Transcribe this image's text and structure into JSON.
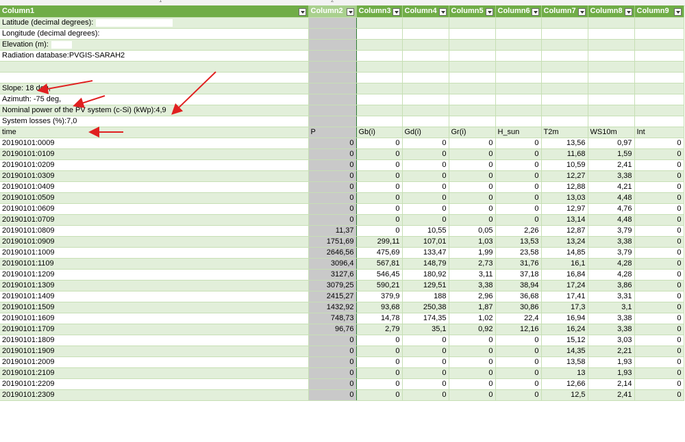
{
  "headers": [
    "Column1",
    "Column2",
    "Column3",
    "Column4",
    "Column5",
    "Column6",
    "Column7",
    "Column8",
    "Column9"
  ],
  "ruler_labels": [
    "1",
    "2"
  ],
  "meta_rows": [
    {
      "text": "Latitude (decimal degrees):",
      "box": true
    },
    {
      "text": "Longitude (decimal degrees):",
      "box": true
    },
    {
      "text": "Elevation (m):",
      "box": true
    },
    {
      "text": "Radiation database:PVGIS-SARAH2",
      "box": false
    },
    {
      "text": "",
      "box": false
    },
    {
      "text": "",
      "box": false
    },
    {
      "text": "Slope: 18 deg,",
      "box": false
    },
    {
      "text": "Azimuth: -75 deg,",
      "box": false
    },
    {
      "text": "Nominal power of the PV system (c-Si) (kWp):4,9",
      "box": false
    },
    {
      "text": "System losses (%):7,0",
      "box": false
    }
  ],
  "field_header": [
    "time",
    "P",
    "Gb(i)",
    "Gd(i)",
    "Gr(i)",
    "H_sun",
    "T2m",
    "WS10m",
    "Int"
  ],
  "rows": [
    [
      "20190101:0009",
      "0",
      "0",
      "0",
      "0",
      "0",
      "13,56",
      "0,97",
      "0"
    ],
    [
      "20190101:0109",
      "0",
      "0",
      "0",
      "0",
      "0",
      "11,68",
      "1,59",
      "0"
    ],
    [
      "20190101:0209",
      "0",
      "0",
      "0",
      "0",
      "0",
      "10,59",
      "2,41",
      "0"
    ],
    [
      "20190101:0309",
      "0",
      "0",
      "0",
      "0",
      "0",
      "12,27",
      "3,38",
      "0"
    ],
    [
      "20190101:0409",
      "0",
      "0",
      "0",
      "0",
      "0",
      "12,88",
      "4,21",
      "0"
    ],
    [
      "20190101:0509",
      "0",
      "0",
      "0",
      "0",
      "0",
      "13,03",
      "4,48",
      "0"
    ],
    [
      "20190101:0609",
      "0",
      "0",
      "0",
      "0",
      "0",
      "12,97",
      "4,76",
      "0"
    ],
    [
      "20190101:0709",
      "0",
      "0",
      "0",
      "0",
      "0",
      "13,14",
      "4,48",
      "0"
    ],
    [
      "20190101:0809",
      "11,37",
      "0",
      "10,55",
      "0,05",
      "2,26",
      "12,87",
      "3,79",
      "0"
    ],
    [
      "20190101:0909",
      "1751,69",
      "299,11",
      "107,01",
      "1,03",
      "13,53",
      "13,24",
      "3,38",
      "0"
    ],
    [
      "20190101:1009",
      "2646,56",
      "475,69",
      "133,47",
      "1,99",
      "23,58",
      "14,85",
      "3,79",
      "0"
    ],
    [
      "20190101:1109",
      "3096,4",
      "567,81",
      "148,79",
      "2,73",
      "31,76",
      "16,1",
      "4,28",
      "0"
    ],
    [
      "20190101:1209",
      "3127,6",
      "546,45",
      "180,92",
      "3,11",
      "37,18",
      "16,84",
      "4,28",
      "0"
    ],
    [
      "20190101:1309",
      "3079,25",
      "590,21",
      "129,51",
      "3,38",
      "38,94",
      "17,24",
      "3,86",
      "0"
    ],
    [
      "20190101:1409",
      "2415,27",
      "379,9",
      "188",
      "2,96",
      "36,68",
      "17,41",
      "3,31",
      "0"
    ],
    [
      "20190101:1509",
      "1432,92",
      "93,68",
      "250,38",
      "1,87",
      "30,86",
      "17,3",
      "3,1",
      "0"
    ],
    [
      "20190101:1609",
      "748,73",
      "14,78",
      "174,35",
      "1,02",
      "22,4",
      "16,94",
      "3,38",
      "0"
    ],
    [
      "20190101:1709",
      "96,76",
      "2,79",
      "35,1",
      "0,92",
      "12,16",
      "16,24",
      "3,38",
      "0"
    ],
    [
      "20190101:1809",
      "0",
      "0",
      "0",
      "0",
      "0",
      "15,12",
      "3,03",
      "0"
    ],
    [
      "20190101:1909",
      "0",
      "0",
      "0",
      "0",
      "0",
      "14,35",
      "2,21",
      "0"
    ],
    [
      "20190101:2009",
      "0",
      "0",
      "0",
      "0",
      "0",
      "13,58",
      "1,93",
      "0"
    ],
    [
      "20190101:2109",
      "0",
      "0",
      "0",
      "0",
      "0",
      "13",
      "1,93",
      "0"
    ],
    [
      "20190101:2209",
      "0",
      "0",
      "0",
      "0",
      "0",
      "12,66",
      "2,14",
      "0"
    ],
    [
      "20190101:2309",
      "0",
      "0",
      "0",
      "0",
      "0",
      "12,5",
      "2,41",
      "0"
    ]
  ],
  "colors": {
    "header": "#70ad47",
    "band": "#e2efda",
    "selected_column": "#c9c9c9",
    "arrow": "#e02020"
  }
}
